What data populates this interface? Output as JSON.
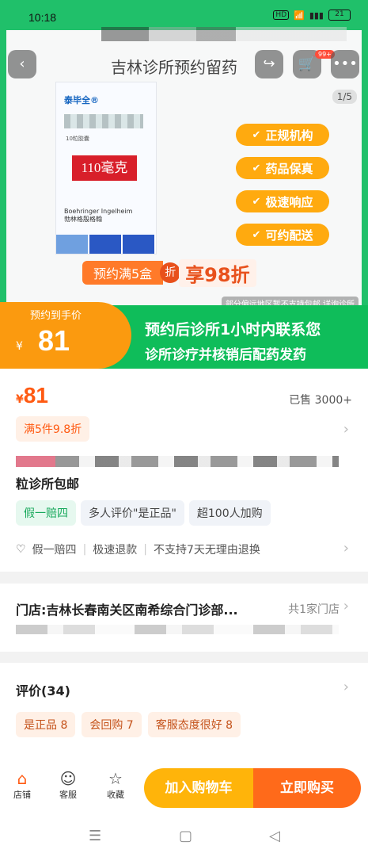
{
  "status": {
    "time": "10:18",
    "hd": "HD",
    "battery": "21"
  },
  "nav": {
    "title": "吉林诊所预约留药",
    "cart_badge": "99+",
    "pager": "1/5"
  },
  "product_image": {
    "brand": "泰毕全®",
    "pack_text": "10粒胶囊",
    "dose": "110毫克",
    "maker": "Boehringer Ingelheim",
    "maker_cn": "勃林格殷格翰",
    "features": [
      "正规机构",
      "药品保真",
      "极速响应",
      "可约配送"
    ],
    "promo_left": "预约满5盒",
    "promo_mid": "折",
    "promo_right": "享98折",
    "region_note": "部分偏远地区暂不支持包邮 详询诊所"
  },
  "banner": {
    "label": "预约到手价",
    "currency": "¥",
    "price": "81",
    "line1": "预约后诊所1小时内联系您",
    "line2": "诊所诊疗并核销后配药发药"
  },
  "main": {
    "currency": "¥",
    "price": "81",
    "sold": "已售 3000+",
    "coupon": "满5件9.8折",
    "title_tail": "粒诊所包邮",
    "pills": [
      "假一赔四",
      "多人评价\"是正品\"",
      "超100人加购"
    ],
    "guarantees": [
      "假一赔四",
      "极速退款",
      "不支持7天无理由退换"
    ]
  },
  "store": {
    "name": "门店:吉林长春南关区南希综合门诊部...",
    "count": "共1家门店"
  },
  "reviews": {
    "title": "评价(34)",
    "tags": [
      "是正品 8",
      "会回购 7",
      "客服态度很好 8"
    ]
  },
  "bottom": {
    "shop": "店铺",
    "service": "客服",
    "favorite": "收藏",
    "add_cart": "加入购物车",
    "buy_now": "立即购买"
  },
  "colors": {
    "green": "#0fbd5a",
    "orange": "#fb9a0f",
    "accent": "#ff5a12"
  }
}
